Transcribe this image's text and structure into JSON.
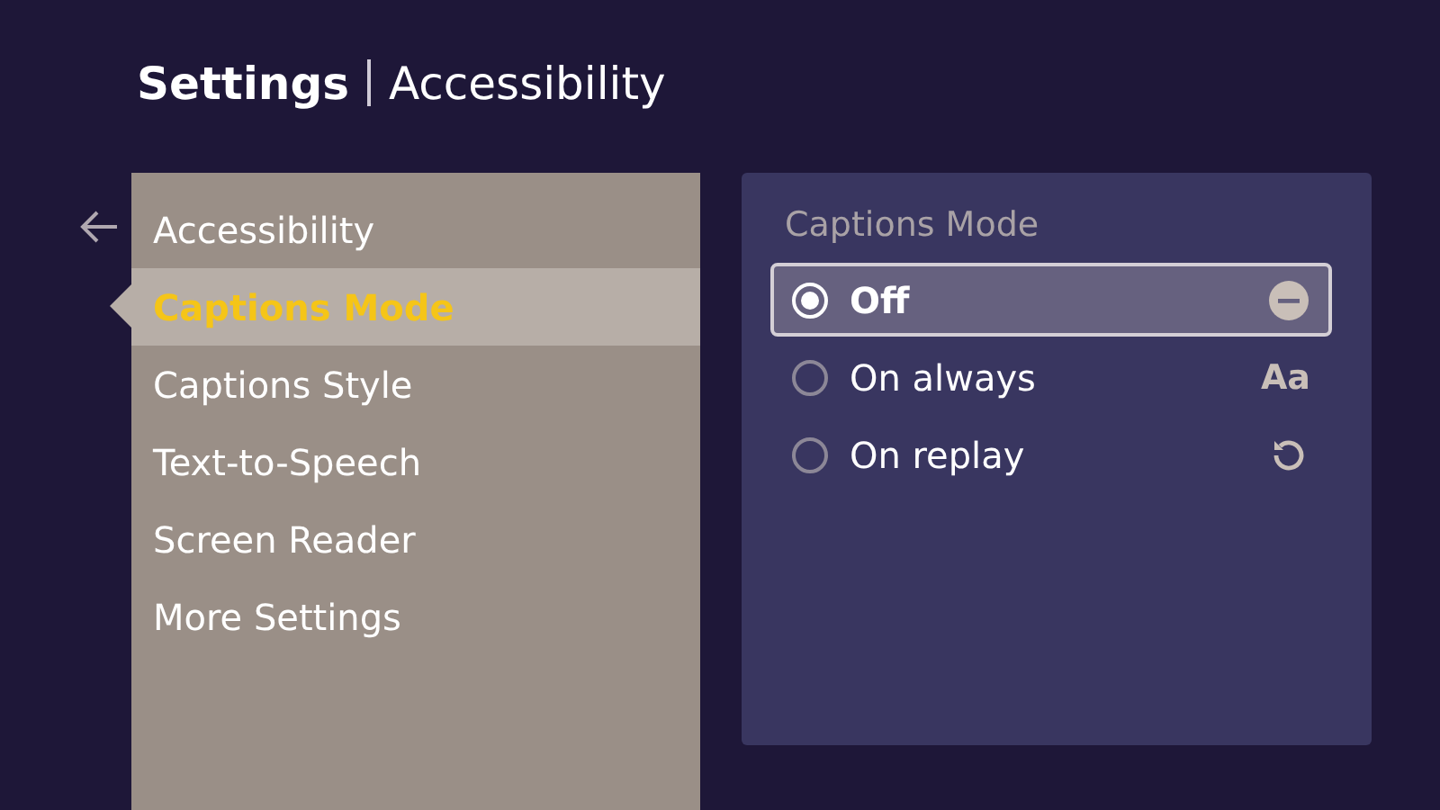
{
  "header": {
    "title": "Settings",
    "subtitle": "Accessibility"
  },
  "menu": {
    "items": [
      {
        "label": "Accessibility",
        "selected": false
      },
      {
        "label": "Captions Mode",
        "selected": true
      },
      {
        "label": "Captions Style",
        "selected": false
      },
      {
        "label": "Text-to-Speech",
        "selected": false
      },
      {
        "label": "Screen Reader",
        "selected": false
      },
      {
        "label": "More Settings",
        "selected": false
      }
    ]
  },
  "panel": {
    "title": "Captions Mode",
    "options": [
      {
        "label": "Off",
        "selected": true,
        "kind": "minus"
      },
      {
        "label": "On always",
        "selected": false,
        "kind": "text",
        "icon_text": "Aa"
      },
      {
        "label": "On replay",
        "selected": false,
        "kind": "replay"
      }
    ]
  }
}
